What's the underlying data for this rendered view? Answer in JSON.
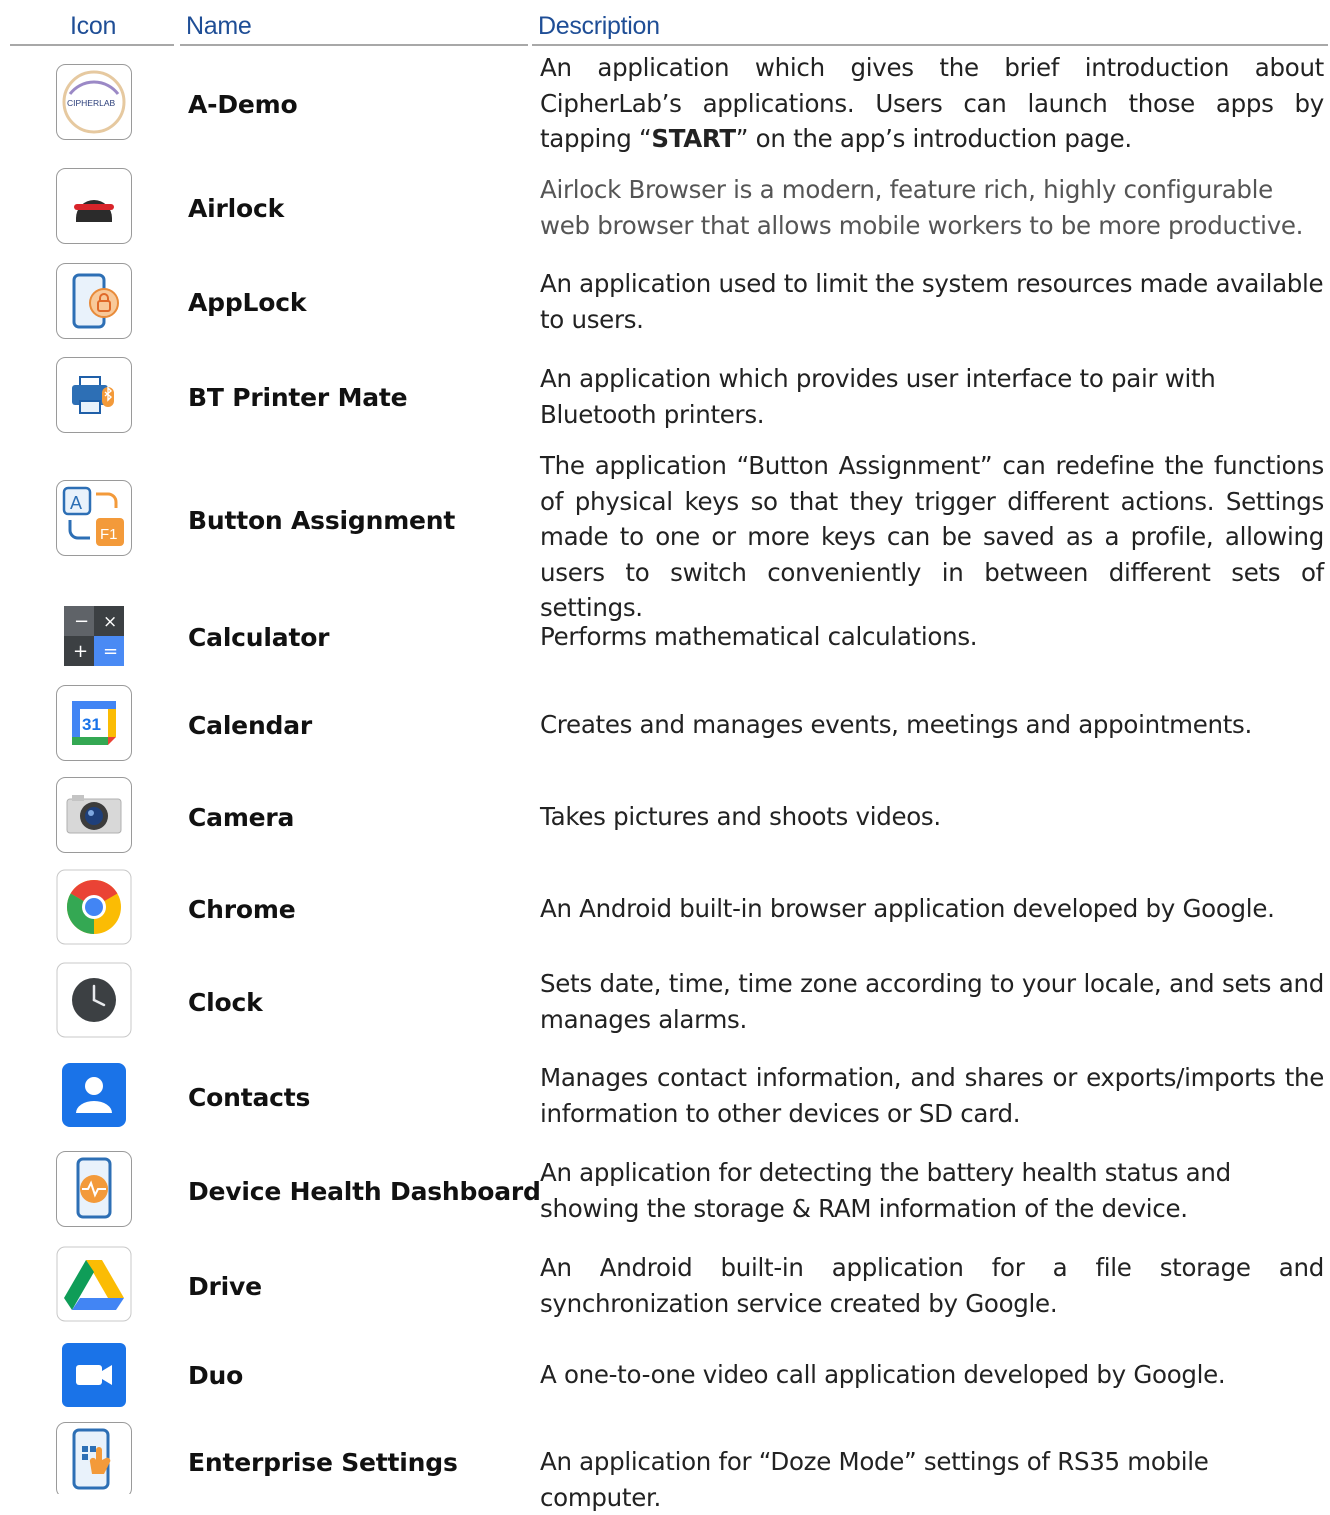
{
  "header": {
    "icon": "Icon",
    "name": "Name",
    "description": "Description"
  },
  "apps": [
    {
      "icon": "a-demo-icon",
      "name": "A-Demo",
      "icon_text": "CIPHERLAB",
      "description_pre": "An application which gives the brief introduction about CipherLab’s applications. Users can launch those apps by tapping “",
      "description_bold": "START",
      "description_post": "” on the app’s introduction page."
    },
    {
      "icon": "airlock-icon",
      "name": "Airlock",
      "description": "Airlock Browser is a modern, feature rich, highly configurable web browser that allows mobile workers to be more productive."
    },
    {
      "icon": "applock-icon",
      "name": "AppLock",
      "description": "An application used to limit the system resources made available to users."
    },
    {
      "icon": "bt-printer-icon",
      "name": "BT Printer Mate",
      "description": "An application which provides user interface to pair with Bluetooth printers."
    },
    {
      "icon": "button-assignment-icon",
      "name": "Button Assignment",
      "description": "The application “Button Assignment” can redefine the functions of physical keys so that they trigger different actions. Settings made to one or more keys can be saved as a profile, allowing users to switch conveniently in between different sets of settings."
    },
    {
      "icon": "calculator-icon",
      "name": "Calculator",
      "description": "Performs mathematical calculations."
    },
    {
      "icon": "calendar-icon",
      "name": "Calendar",
      "icon_text": "31",
      "description": "Creates and manages events, meetings and appointments."
    },
    {
      "icon": "camera-icon",
      "name": "Camera",
      "description": "Takes pictures and shoots videos."
    },
    {
      "icon": "chrome-icon",
      "name": "Chrome",
      "description": "An Android built-in browser application developed by Google."
    },
    {
      "icon": "clock-icon",
      "name": "Clock",
      "description": "Sets date, time, time zone according to your locale, and sets and manages alarms."
    },
    {
      "icon": "contacts-icon",
      "name": "Contacts",
      "description": "Manages contact information, and shares or exports/imports the information to other devices or SD card."
    },
    {
      "icon": "device-health-icon",
      "name": "Device Health Dashboard",
      "description": "An application for detecting the battery health status and showing the storage & RAM information of the device."
    },
    {
      "icon": "drive-icon",
      "name": "Drive",
      "description": "An Android built-in application for a file storage and synchronization service created by Google."
    },
    {
      "icon": "duo-icon",
      "name": "Duo",
      "description": "A one-to-one video call application developed by Google."
    },
    {
      "icon": "enterprise-settings-icon",
      "name": "Enterprise Settings",
      "description": "An application for “Doze Mode” settings of RS35 mobile computer."
    }
  ]
}
